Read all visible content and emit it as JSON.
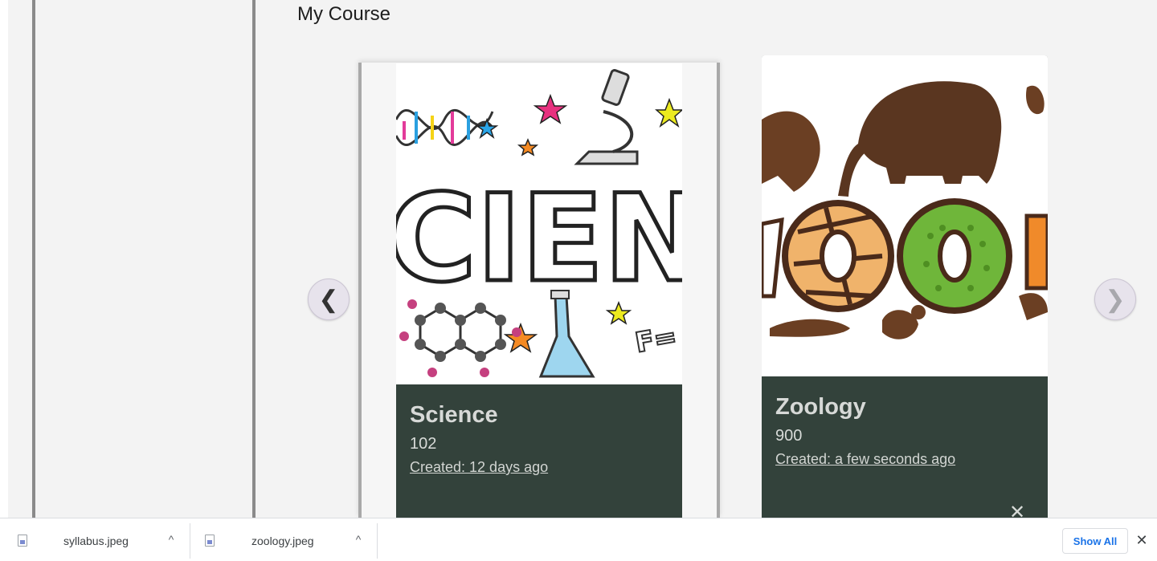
{
  "page": {
    "title": "My Course"
  },
  "carousel": {
    "prev_label": "❮",
    "next_label": "❯"
  },
  "courses": [
    {
      "title": "Science",
      "code": "102",
      "created": "Created: 12 days ago",
      "image_text": "CIENC"
    },
    {
      "title": "Zoology",
      "code": "900",
      "created": "Created: a few seconds ago",
      "close_label": "✕"
    }
  ],
  "downloads": {
    "items": [
      {
        "name": "syllabus.jpeg"
      },
      {
        "name": "zoology.jpeg"
      }
    ],
    "caret_label": "^",
    "show_all_label": "Show All",
    "close_label": "✕"
  }
}
